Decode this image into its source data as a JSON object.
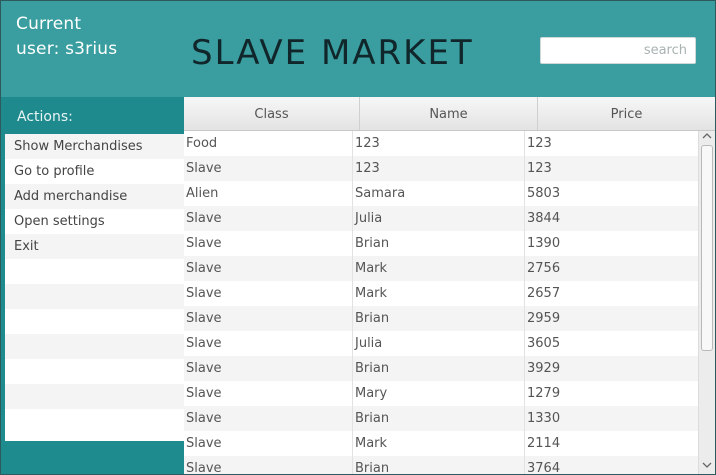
{
  "header": {
    "current_user_line1": "Current",
    "current_user_line2": "user: s3rius",
    "title": "SLAVE MARKET",
    "search_placeholder": "search",
    "search_value": ""
  },
  "sidebar": {
    "heading": "Actions:",
    "items": [
      {
        "label": "Show Merchandises"
      },
      {
        "label": "Go to profile"
      },
      {
        "label": "Add merchandise"
      },
      {
        "label": "Open settings"
      },
      {
        "label": "Exit"
      }
    ]
  },
  "table": {
    "columns": [
      "Class",
      "Name",
      "Price"
    ],
    "rows": [
      [
        "Food",
        "123",
        "123"
      ],
      [
        "Slave",
        "123",
        "123"
      ],
      [
        "Alien",
        "Samara",
        "5803"
      ],
      [
        "Slave",
        "Julia",
        "3844"
      ],
      [
        "Slave",
        "Brian",
        "1390"
      ],
      [
        "Slave",
        "Mark",
        "2756"
      ],
      [
        "Slave",
        "Mark",
        "2657"
      ],
      [
        "Slave",
        "Brian",
        "2959"
      ],
      [
        "Slave",
        "Julia",
        "3605"
      ],
      [
        "Slave",
        "Brian",
        "3929"
      ],
      [
        "Slave",
        "Mary",
        "1279"
      ],
      [
        "Slave",
        "Brian",
        "1330"
      ],
      [
        "Slave",
        "Mark",
        "2114"
      ],
      [
        "Slave",
        "Brian",
        "3764"
      ]
    ]
  },
  "icons": {
    "scroll_up": "chevron-up-icon",
    "scroll_down": "chevron-down-icon"
  },
  "colors": {
    "header_bg": "#3a9ea0",
    "sidebar_bg": "#1e8b8e",
    "title_color": "#10262a"
  }
}
